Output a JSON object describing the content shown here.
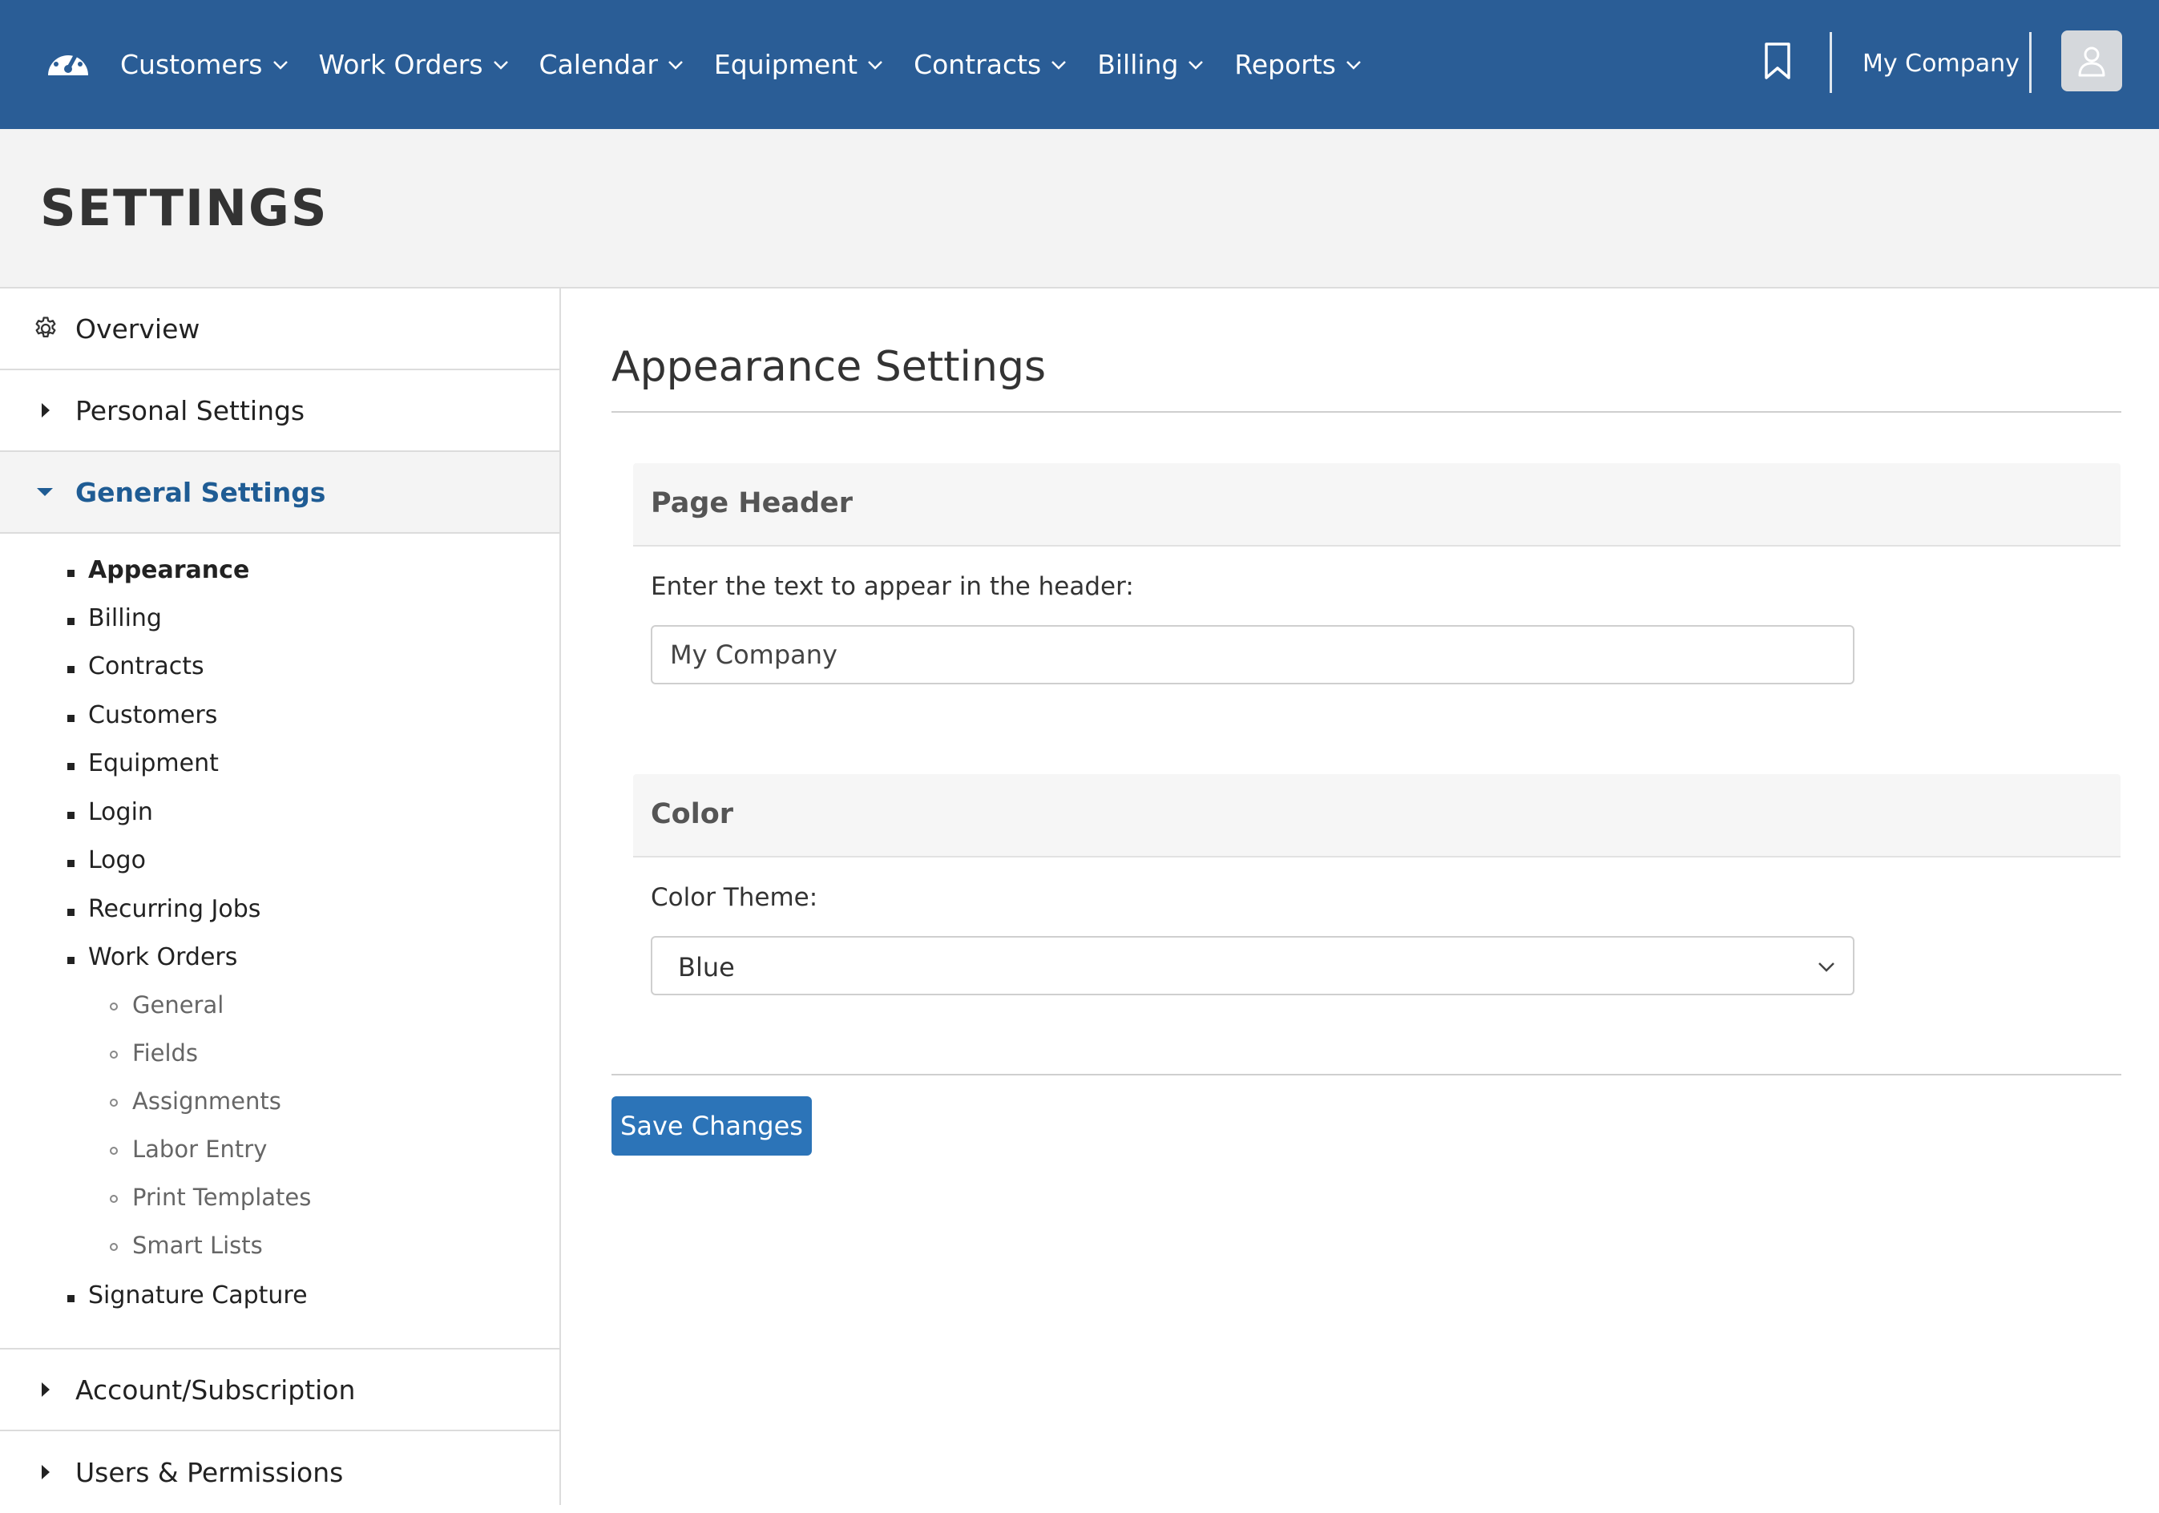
{
  "nav": {
    "items": [
      {
        "label": "Customers"
      },
      {
        "label": "Work Orders"
      },
      {
        "label": "Calendar"
      },
      {
        "label": "Equipment"
      },
      {
        "label": "Contracts"
      },
      {
        "label": "Billing"
      },
      {
        "label": "Reports"
      }
    ],
    "company": "My Company",
    "icons": {
      "logo": "dashboard-gauge-icon",
      "bookmark": "bookmark-icon",
      "avatar": "user-icon"
    }
  },
  "page": {
    "title": "SETTINGS"
  },
  "sidebar": {
    "overview": "Overview",
    "personal": "Personal Settings",
    "general": "General Settings",
    "general_items": [
      "Appearance",
      "Billing",
      "Contracts",
      "Customers",
      "Equipment",
      "Login",
      "Logo",
      "Recurring Jobs",
      "Work Orders"
    ],
    "work_order_items": [
      "General",
      "Fields",
      "Assignments",
      "Labor Entry",
      "Print Templates",
      "Smart Lists"
    ],
    "signature": "Signature Capture",
    "account": "Account/Subscription",
    "users": "Users & Permissions",
    "colors": {
      "active": "#1f5c94"
    }
  },
  "main": {
    "title": "Appearance Settings",
    "header_panel": {
      "title": "Page Header",
      "label": "Enter the text to appear in the header:",
      "value": "My Company"
    },
    "color_panel": {
      "title": "Color",
      "label": "Color Theme:",
      "selected": "Blue"
    },
    "save_label": "Save Changes"
  },
  "colors": {
    "nav_bg": "#2a5d96",
    "button": "#2c74b8"
  }
}
